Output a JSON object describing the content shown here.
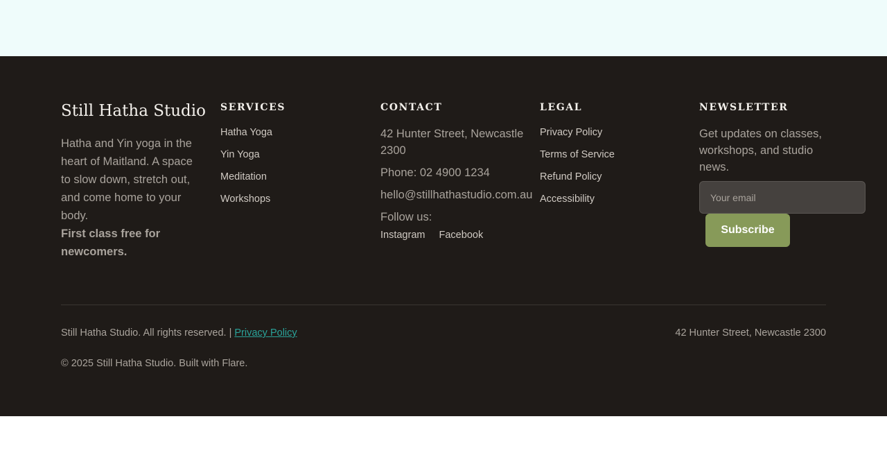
{
  "brand": {
    "name": "Still Hatha Studio",
    "description": "Hatha and Yin yoga in the heart of Maitland. A space to slow down, stretch out, and come home to your body.",
    "highlight": "First class free for newcomers."
  },
  "services": {
    "heading": "SERVICES",
    "items": [
      {
        "label": "Hatha Yoga"
      },
      {
        "label": "Yin Yoga"
      },
      {
        "label": "Meditation"
      },
      {
        "label": "Workshops"
      }
    ]
  },
  "contact": {
    "heading": "CONTACT",
    "address": "42 Hunter Street, Newcastle 2300",
    "phone": "Phone: 02 4900 1234",
    "email": "hello@stillhathastudio.com.au",
    "follow_label": "Follow us:",
    "social": [
      {
        "label": "Instagram"
      },
      {
        "label": "Facebook"
      }
    ]
  },
  "legal": {
    "heading": "LEGAL",
    "items": [
      {
        "label": "Privacy Policy"
      },
      {
        "label": "Terms of Service"
      },
      {
        "label": "Refund Policy"
      },
      {
        "label": "Accessibility"
      }
    ]
  },
  "newsletter": {
    "heading": "NEWSLETTER",
    "description": "Get updates on classes, workshops, and studio news.",
    "input_placeholder": "Your email",
    "input_value": "",
    "button_label": "Subscribe"
  },
  "bottom": {
    "rights_text": "Still Hatha Studio. All rights reserved. |",
    "privacy_link": "Privacy Policy",
    "address": "42 Hunter Street, Newcastle 2300",
    "copyright": "© 2025 Still Hatha Studio. Built with Flare."
  },
  "colors": {
    "footer_bg": "#1f1b18",
    "top_band": "#effcfb",
    "accent_button": "#879a59",
    "link_accent": "#2aa39a"
  }
}
